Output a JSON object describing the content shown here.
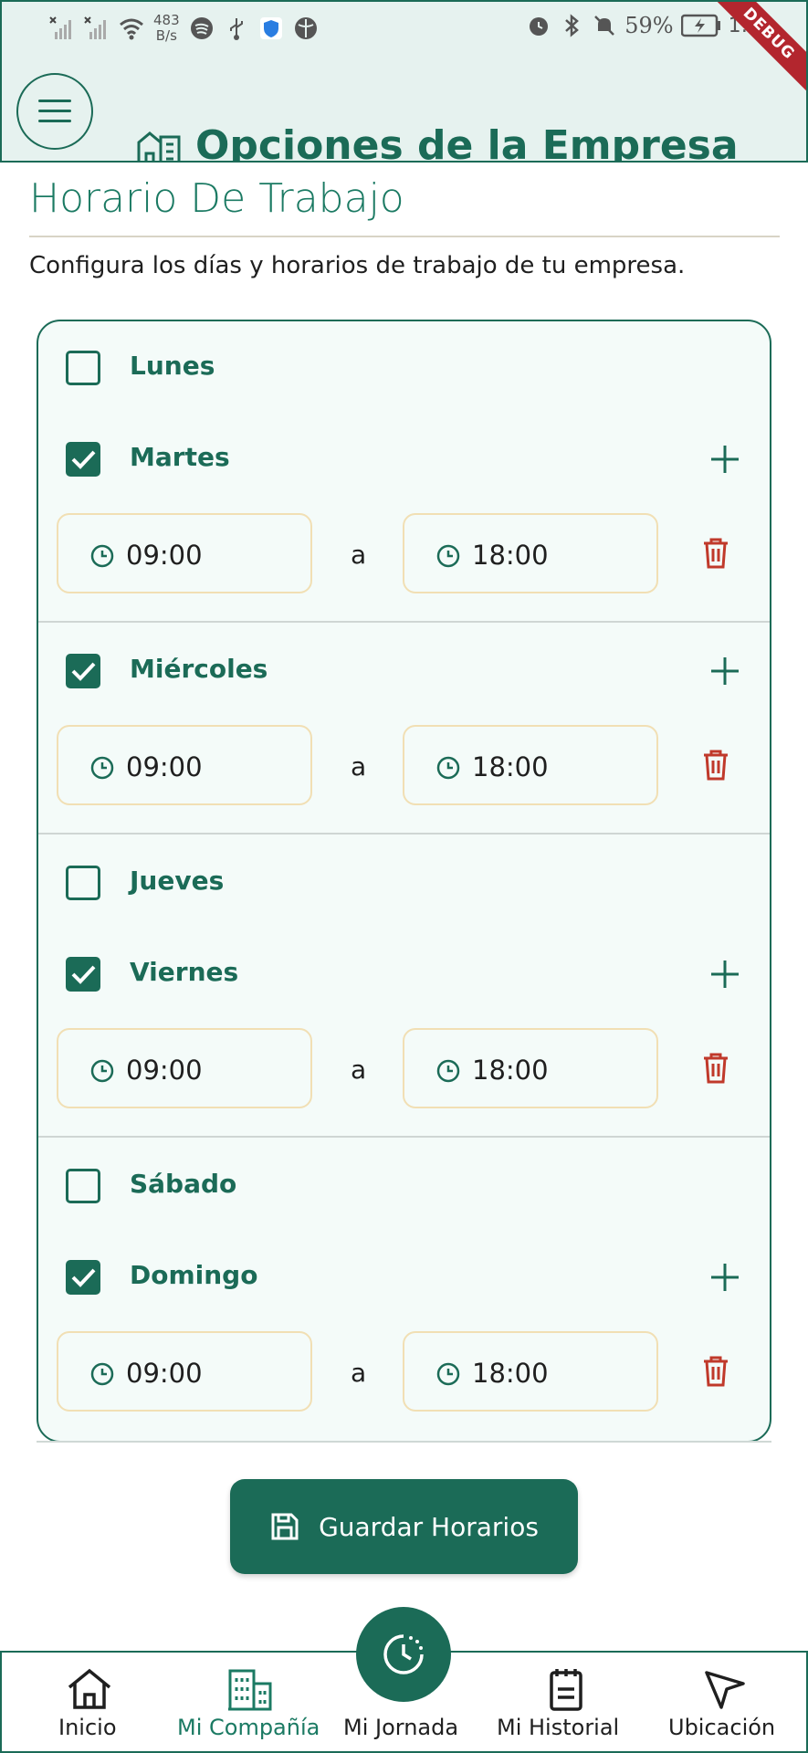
{
  "status_bar": {
    "net_speed_value": "483",
    "net_speed_unit": "B/s",
    "battery": "59%",
    "time": "1:28",
    "debug_label": "DEBUG"
  },
  "header": {
    "title": "Opciones de la Empresa"
  },
  "section": {
    "title": "Horario De Trabajo",
    "description": "Configura los días y horarios de trabajo de tu empresa."
  },
  "schedule": {
    "separator": "a",
    "days": [
      {
        "name": "Lunes",
        "checked": false
      },
      {
        "name": "Martes",
        "checked": true,
        "start": "09:00",
        "end": "18:00"
      },
      {
        "name": "Miércoles",
        "checked": true,
        "start": "09:00",
        "end": "18:00"
      },
      {
        "name": "Jueves",
        "checked": false
      },
      {
        "name": "Viernes",
        "checked": true,
        "start": "09:00",
        "end": "18:00"
      },
      {
        "name": "Sábado",
        "checked": false
      },
      {
        "name": "Domingo",
        "checked": true,
        "start": "09:00",
        "end": "18:00"
      }
    ]
  },
  "actions": {
    "save_label": "Guardar Horarios"
  },
  "nav": {
    "items": [
      {
        "label": "Inicio",
        "icon": "home-icon"
      },
      {
        "label": "Mi Compañía",
        "icon": "building-icon",
        "active": true
      },
      {
        "label": "Mi Jornada",
        "icon": "clock-icon"
      },
      {
        "label": "Mi Historial",
        "icon": "clipboard-icon"
      },
      {
        "label": "Ubicación",
        "icon": "navigation-arrow-icon"
      }
    ]
  },
  "colors": {
    "primary": "#1b6b57",
    "header_bg": "#e6f2ef",
    "card_bg": "#f4fbf9",
    "time_border": "#f1dfb4",
    "danger": "#c0392b",
    "debug": "#b3262e"
  }
}
